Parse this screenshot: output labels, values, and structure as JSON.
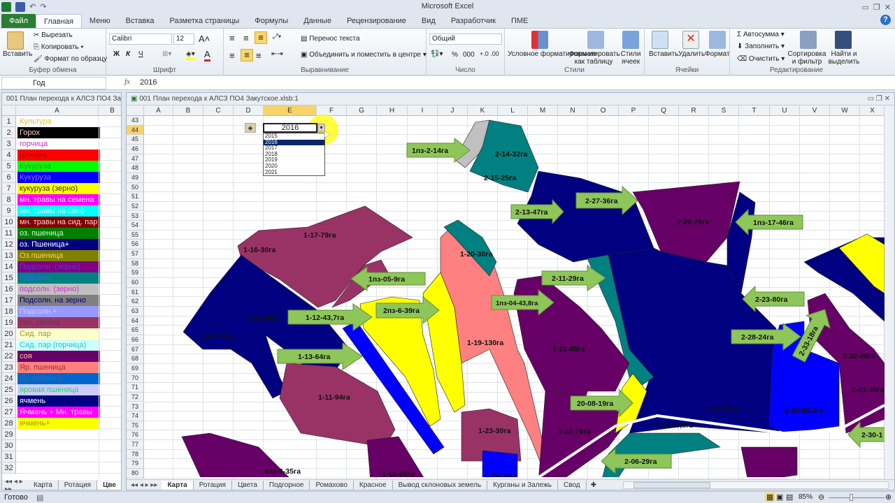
{
  "app": {
    "title": "Microsoft Excel"
  },
  "tabs": [
    "Файл",
    "Главная",
    "Меню",
    "Вставка",
    "Разметка страницы",
    "Формулы",
    "Данные",
    "Рецензирование",
    "Вид",
    "Разработчик",
    "ПМЕ"
  ],
  "ribbon": {
    "clipboard": {
      "paste": "Вставить",
      "cut": "Вырезать",
      "copy": "Копировать",
      "format_painter": "Формат по образцу",
      "label": "Буфер обмена"
    },
    "font": {
      "name": "Calibri",
      "size": "12",
      "bold": "Ж",
      "italic": "К",
      "underline": "Ч",
      "label": "Шрифт"
    },
    "alignment": {
      "wrap": "Перенос текста",
      "merge": "Объединить и поместить в центре",
      "label": "Выравнивание"
    },
    "number": {
      "format": "Общий",
      "percent": "%",
      "thousands": "000",
      "label": "Число"
    },
    "styles": {
      "conditional": "Условное форматирование",
      "as_table": "Форматировать как таблицу",
      "cell_styles": "Стили ячеек",
      "label": "Стили"
    },
    "cells": {
      "insert": "Вставить",
      "delete": "Удалить",
      "format": "Формат",
      "label": "Ячейки"
    },
    "editing": {
      "autosum": "Автосумма",
      "fill": "Заполнить",
      "clear": "Очистить",
      "sort": "Сортировка и фильтр",
      "find": "Найти и выделить",
      "label": "Редактирование"
    }
  },
  "formula_bar": {
    "name_box": "Год",
    "fx": "fx",
    "value": "2016"
  },
  "left_window": {
    "title": "001 План перехода к АЛСЗ ПО4 Заку...",
    "columns": [
      "A",
      "B"
    ],
    "legend": [
      {
        "text": "Культура",
        "bg": "#ffffff",
        "fg": "#e0c040"
      },
      {
        "text": "Горох",
        "bg": "#000000",
        "fg": "#ffd0d0"
      },
      {
        "text": "горчица",
        "bg": "#ffffff",
        "fg": "#cc33cc"
      },
      {
        "text": "гречиха",
        "bg": "#ff0000",
        "fg": "#990000"
      },
      {
        "text": "Кукуруза",
        "bg": "#00ff00",
        "fg": "#339933"
      },
      {
        "text": "Кукуруза",
        "bg": "#0000ff",
        "fg": "#9966ff"
      },
      {
        "text": "кукуруза (зерно)",
        "bg": "#ffff00",
        "fg": "#333300"
      },
      {
        "text": "мн. травы на семена",
        "bg": "#ff00ff",
        "fg": "#ffd6ff"
      },
      {
        "text": "мн. травы на сено",
        "bg": "#00ffff",
        "fg": "#d6ffff"
      },
      {
        "text": "мн. травы на сид. пар",
        "bg": "#800000",
        "fg": "#ffcccc"
      },
      {
        "text": "оз. пшеница",
        "bg": "#008000",
        "fg": "#ccffcc"
      },
      {
        "text": "оз. Пшеница+",
        "bg": "#000080",
        "fg": "#ffffff"
      },
      {
        "text": "Оз.пшеница",
        "bg": "#808000",
        "fg": "#ffcc66"
      },
      {
        "text": "Подсолн. (зерно)",
        "bg": "#800080",
        "fg": "#6633cc"
      },
      {
        "text": "Подсолн.",
        "bg": "#008080",
        "fg": "#3366ff"
      },
      {
        "text": "подсолн. (зерно)",
        "bg": "#c0c0c0",
        "fg": "#cc33cc"
      },
      {
        "text": "Подсолн. на зерно",
        "bg": "#808080",
        "fg": "#000066"
      },
      {
        "text": "Подсолн.+",
        "bg": "#9999ff",
        "fg": "#ccccff"
      },
      {
        "text": "сах. свекла",
        "bg": "#993366",
        "fg": "#663355"
      },
      {
        "text": "Сид. пар",
        "bg": "#ffffcc",
        "fg": "#999933"
      },
      {
        "text": "Сид. пар (горчица)",
        "bg": "#ccffff",
        "fg": "#33bbcc"
      },
      {
        "text": "соя",
        "bg": "#660066",
        "fg": "#ffcc99"
      },
      {
        "text": "Яр. пшеница",
        "bg": "#ff8080",
        "fg": "#993333"
      },
      {
        "text": "Яр.пшеница",
        "bg": "#0066cc",
        "fg": "#3366aa"
      },
      {
        "text": "яровая пшеница",
        "bg": "#ccccff",
        "fg": "#33cc66"
      },
      {
        "text": "ячмень",
        "bg": "#000080",
        "fg": "#ffffff"
      },
      {
        "text": "Ячмень + Мн. травы",
        "bg": "#ff00ff",
        "fg": "#ffccff"
      },
      {
        "text": "ячмень+",
        "bg": "#ffff00",
        "fg": "#999900"
      }
    ],
    "row_numbers": [
      1,
      2,
      3,
      4,
      5,
      6,
      7,
      8,
      9,
      10,
      11,
      12,
      13,
      14,
      15,
      16,
      17,
      18,
      19,
      20,
      21,
      22,
      23,
      24,
      25,
      26,
      27,
      28,
      29,
      30,
      31,
      32
    ],
    "sheet_tabs": [
      "Карта",
      "Ротация",
      "Цве"
    ]
  },
  "main_window": {
    "title": "001 План перехода к АЛСЗ ПО4 Закутское.xlsb:1",
    "columns": [
      "A",
      "B",
      "C",
      "D",
      "E",
      "F",
      "G",
      "H",
      "I",
      "J",
      "K",
      "L",
      "M",
      "N",
      "O",
      "P",
      "Q",
      "R",
      "S",
      "T",
      "U",
      "V",
      "W",
      "X"
    ],
    "row_numbers": [
      43,
      44,
      45,
      46,
      47,
      48,
      49,
      50,
      51,
      52,
      53,
      54,
      55,
      56,
      57,
      58,
      59,
      60,
      61,
      62,
      63,
      64,
      65,
      66,
      67,
      68,
      69,
      70,
      71,
      72,
      73,
      74,
      75,
      76,
      77,
      78,
      79,
      80
    ],
    "year_cell": "2016",
    "year_options": [
      "2015",
      "2016",
      "2017",
      "2018",
      "2019",
      "2020",
      "2021"
    ],
    "year_selected": "2016",
    "sheet_tabs": [
      "Карта",
      "Ротация",
      "Цвета",
      "Подгорное",
      "Ромахово",
      "Красное",
      "Вывод склоновых земель",
      "Курганы и Залежь",
      "Свод"
    ],
    "arrows": [
      "1пз-2-14га",
      "2-13-47га",
      "2-27-36га",
      "1пз-17-46га",
      "1пз-05-9га",
      "2-11-29га",
      "1пз-04-43,8га",
      "2-23-80га",
      "1-12-43,7га",
      "2пз-6-39га",
      "2-28-24га",
      "2-33-18га",
      "1-13-64га",
      "20-08-19га",
      "2-06-29га",
      "2-30-1"
    ],
    "labels": [
      "2-14-32га",
      "2-15-25га",
      "2-26-79га",
      "1-17-79га",
      "1-16-30га",
      "1-20-30га",
      "1-15-88,2",
      "1-14-49га",
      "1-19-130га",
      "1-21-85га",
      "2-32-40га",
      "2-31-35га",
      "1-11-94га",
      "2-22-79га",
      "2-29-65,3га",
      "2-07-20,8га",
      "1-23-30га",
      "1-22-78га",
      "1-10-69га",
      "1пз-6-35га",
      "1-24-29га"
    ]
  },
  "status": {
    "ready": "Готово",
    "zoom": "85%"
  }
}
